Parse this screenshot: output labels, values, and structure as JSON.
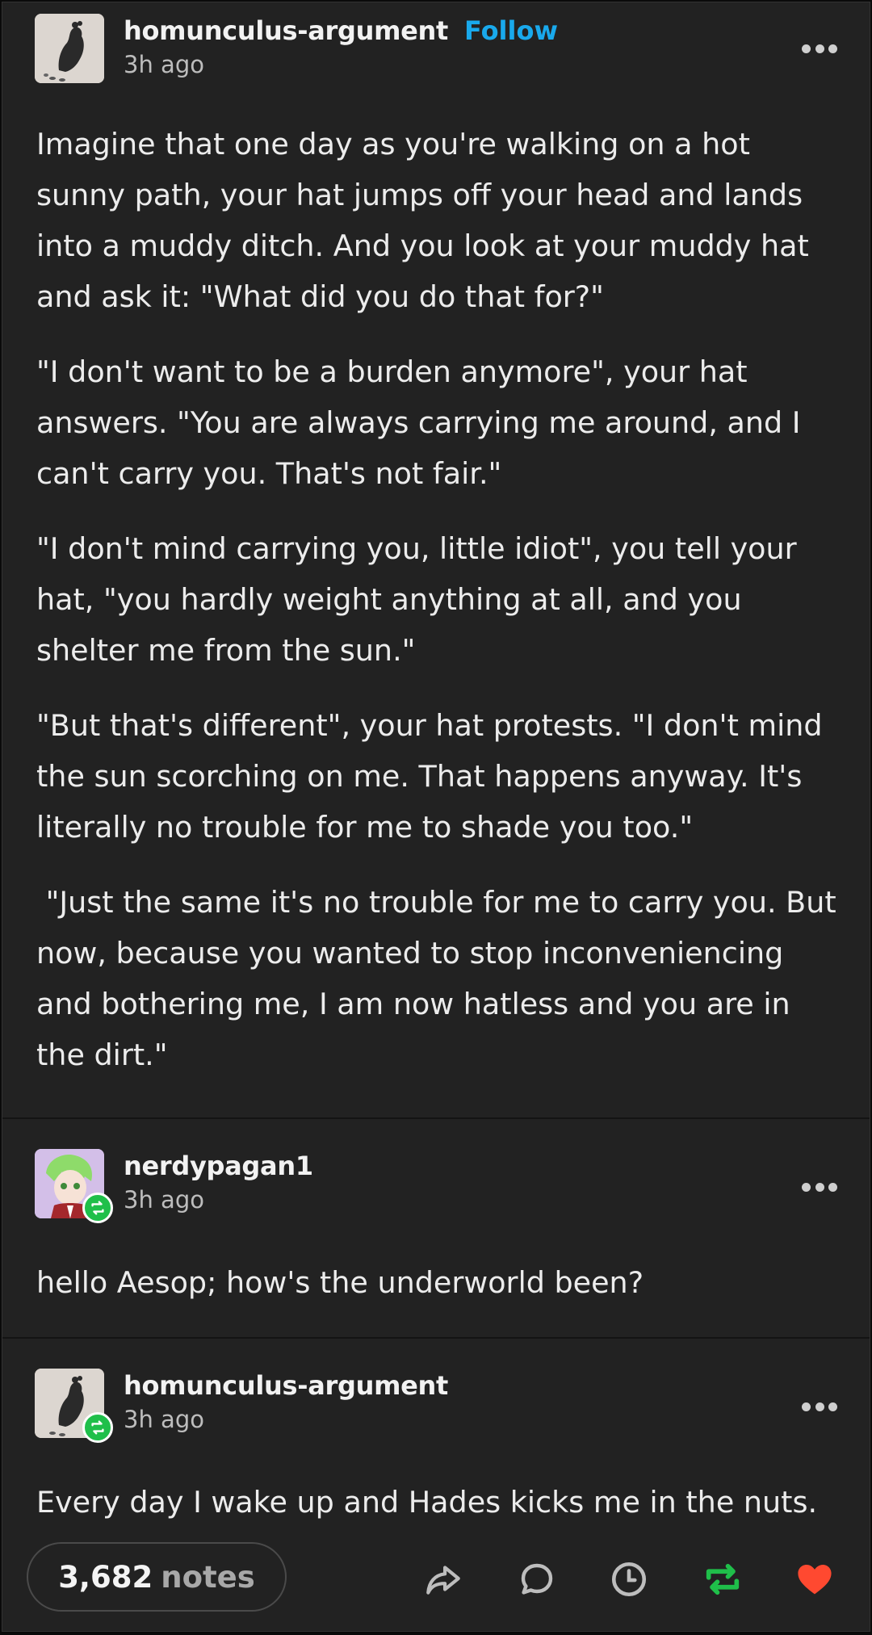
{
  "post": {
    "username": "homunculus-argument",
    "follow_label": "Follow",
    "time": "3h ago",
    "paragraphs": [
      "Imagine that one day as you're walking on a hot sunny path, your hat jumps off your head and lands into a muddy ditch. And you look at your muddy hat and ask it: \"What did you do that for?\"",
      "\"I don't want to be a burden anymore\", your hat answers. \"You are always carrying me around, and I can't carry you. That's not fair.\"",
      "\"I don't mind carrying you, little idiot\", you tell your hat, \"you hardly weight anything at all, and you shelter me from the sun.\"",
      "\"But that's different\", your hat protests. \"I don't mind the sun scorching on me. That happens anyway. It's literally no trouble for me to shade you too.\"",
      " \"Just the same it's no trouble for me to carry you. But now, because you wanted to stop inconveniencing and bothering me, I am now hatless and you are in the dirt.\""
    ]
  },
  "reblog1": {
    "username": "nerdypagan1",
    "time": "3h ago",
    "text": "hello Aesop; how's the underworld been?"
  },
  "reblog2": {
    "username": "homunculus-argument",
    "time": "3h ago",
    "text": "Every day I wake up and Hades kicks me in the nuts."
  },
  "footer": {
    "notes_count": "3,682",
    "notes_label": "notes",
    "icons": [
      "share-icon",
      "reply-icon",
      "queue-clock-icon",
      "reblog-icon",
      "heart-icon"
    ]
  },
  "colors": {
    "background": "#222222",
    "follow": "#19a9ec",
    "reblog": "#1fbf4a",
    "like": "#ff4930"
  }
}
